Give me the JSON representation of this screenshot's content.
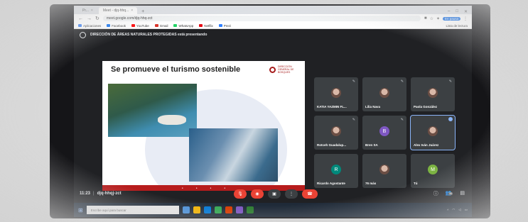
{
  "browser": {
    "tabs": [
      {
        "label": "Pr...",
        "active": false
      },
      {
        "label": "Meet - djq-hhq...",
        "active": true
      },
      {
        "label": "",
        "active": false
      }
    ],
    "url": "meet.google.com/djq-hhq-zct",
    "profile_badge": "En pausa",
    "bookmarks": [
      "Aplicaciones",
      "Facebook",
      "YouTube",
      "Gmail",
      "WhatsApp",
      "Netflix",
      "Prezi"
    ],
    "reading_list": "Lista de lectura"
  },
  "meet": {
    "presenting_text": "DIRECCIÓN DE ÁREAS NATURALES PROTEGIDAS está presentando",
    "slide": {
      "title": "Se promueve el turismo sostenible",
      "logo_text": "DIRECCIÓN GENERAL DE BOSQUES"
    },
    "participants": [
      {
        "name": "KATIA YAZMIN FL...",
        "avatar": "",
        "avatar_color": "#6b4e44",
        "highlight": false
      },
      {
        "name": "Lilia Nava",
        "avatar": "",
        "avatar_color": "#1e88e5",
        "highlight": false
      },
      {
        "name": "Paola González",
        "avatar": "",
        "avatar_color": "#6b4e44",
        "highlight": false
      },
      {
        "name": "Rotceh Guadalup...",
        "avatar": "",
        "avatar_color": "#6b4e44",
        "highlight": false
      },
      {
        "name": "Bren SA",
        "avatar": "B",
        "avatar_color": "#7e57c2",
        "highlight": false
      },
      {
        "name": "Alex Iván Juárez",
        "avatar": "",
        "avatar_color": "#6b4e44",
        "highlight": true
      },
      {
        "name": "Ricardo Agostante",
        "avatar": "R",
        "avatar_color": "#00897b",
        "highlight": false
      },
      {
        "name": "76 más",
        "avatar": "",
        "avatar_color": "#6b4e44",
        "highlight": false
      },
      {
        "name": "Tú",
        "avatar": "M",
        "avatar_color": "#7cb342",
        "highlight": false
      }
    ],
    "time": "11:23",
    "meeting_code": "djq-hhqj-zct",
    "participant_count": "86"
  },
  "taskbar": {
    "search_placeholder": "Escribe aquí para buscar"
  }
}
